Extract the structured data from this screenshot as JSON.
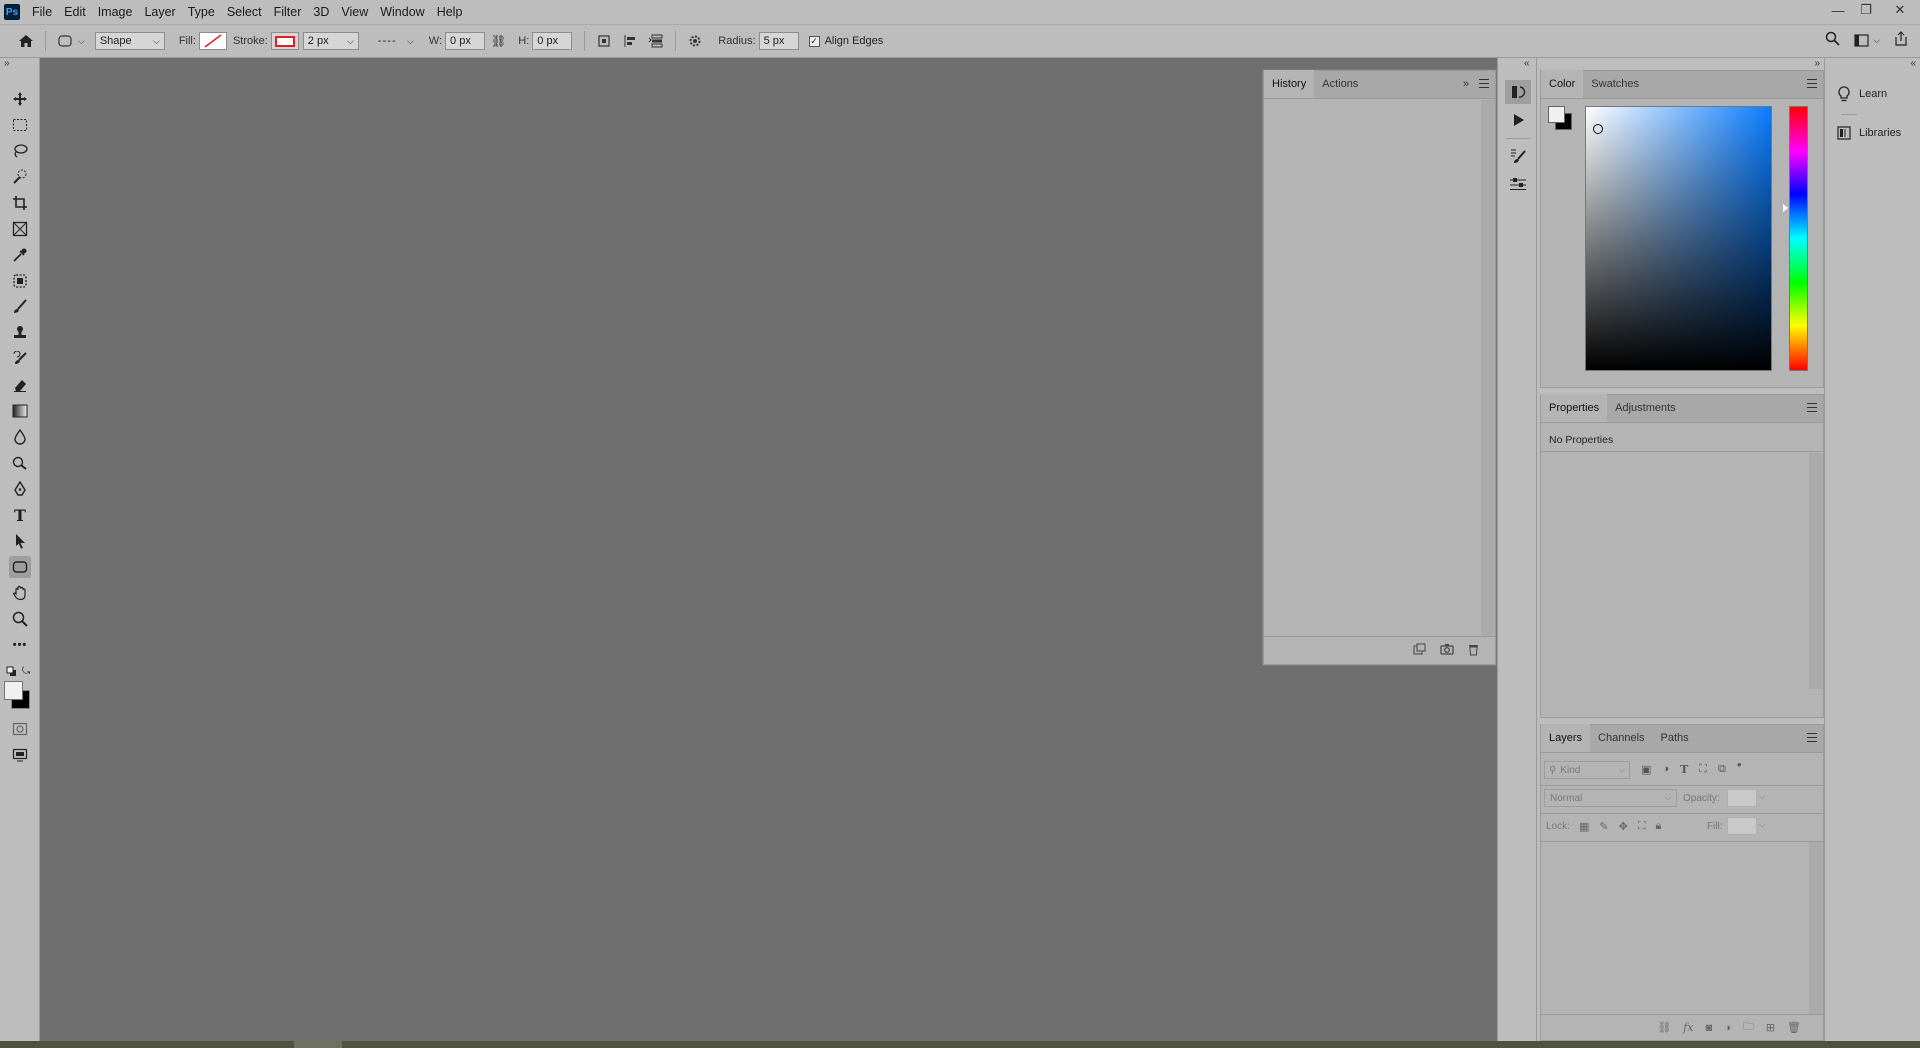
{
  "app": {
    "logo": "Ps"
  },
  "menu": [
    "File",
    "Edit",
    "Image",
    "Layer",
    "Type",
    "Select",
    "Filter",
    "3D",
    "View",
    "Window",
    "Help"
  ],
  "window_controls": {
    "minimize": "—",
    "restore": "❐",
    "close": "✕"
  },
  "options": {
    "mode": "Shape",
    "fill_label": "Fill:",
    "stroke_label": "Stroke:",
    "stroke_width": "2 px",
    "w_label": "W:",
    "w_value": "0 px",
    "h_label": "H:",
    "h_value": "0 px",
    "radius_label": "Radius:",
    "radius_value": "5 px",
    "align_edges": "Align Edges",
    "align_edges_checked": true,
    "stroke_color": "#e02020"
  },
  "history_panel": {
    "tabs": [
      "History",
      "Actions"
    ],
    "active_tab": "History"
  },
  "color_panel": {
    "tabs": [
      "Color",
      "Swatches"
    ],
    "active_tab": "Color"
  },
  "properties_panel": {
    "tabs": [
      "Properties",
      "Adjustments"
    ],
    "active_tab": "Properties",
    "empty_text": "No Properties"
  },
  "layers_panel": {
    "tabs": [
      "Layers",
      "Channels",
      "Paths"
    ],
    "active_tab": "Layers",
    "filter_placeholder": "Kind",
    "blend_mode": "Normal",
    "opacity_label": "Opacity:",
    "lock_label": "Lock:",
    "fill_label": "Fill:"
  },
  "learn_panel": {
    "items": [
      "Learn",
      "Libraries"
    ]
  },
  "colors": {
    "foreground": "#f0f0f0",
    "background": "#000000",
    "canvas": "#6f6f6f"
  }
}
